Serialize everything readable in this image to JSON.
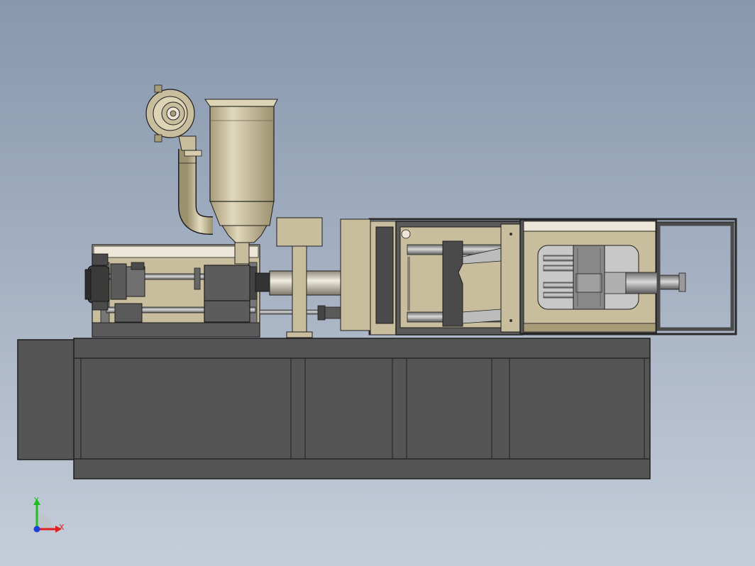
{
  "scene": {
    "colors": {
      "background_top": "#8797ad",
      "background_bottom": "#c5cdd9",
      "base": "#555555",
      "tan": "#c8bd9c",
      "tan_dark": "#a89c78",
      "edge": "#1e1e1e"
    }
  },
  "triad": {
    "x_label": "X",
    "y_label": "Y",
    "x_color": "#e01f1f",
    "y_color": "#1fbf1f",
    "z_color": "#1f3fd9"
  }
}
